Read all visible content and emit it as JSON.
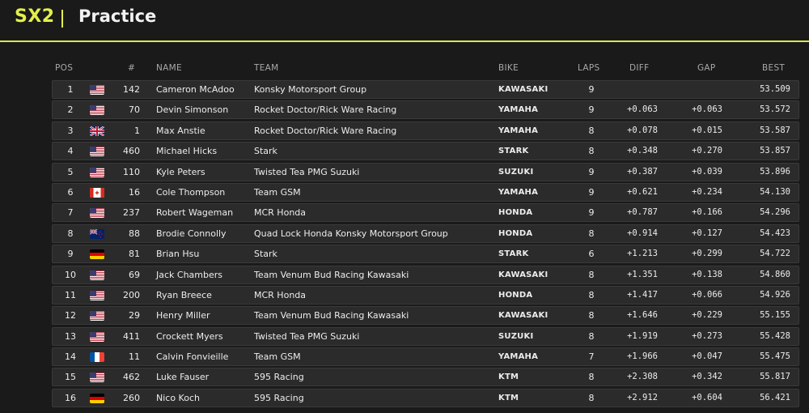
{
  "header": {
    "series": "SX2",
    "title": "Practice"
  },
  "columns": {
    "pos": "POS",
    "num": "#",
    "name": "NAME",
    "team": "TEAM",
    "bike": "BIKE",
    "laps": "LAPS",
    "diff": "DIFF",
    "gap": "GAP",
    "best": "BEST"
  },
  "colors": {
    "accent": "#e2f04a",
    "row_bg": "#2b2b2b",
    "page_bg": "#1a1a1a"
  },
  "rows": [
    {
      "pos": "1",
      "flag": "us-flag",
      "num": "142",
      "name": "Cameron McAdoo",
      "team": "Konsky Motorsport Group",
      "bike": "KAWASAKI",
      "laps": "9",
      "diff": "",
      "gap": "",
      "best": "53.509"
    },
    {
      "pos": "2",
      "flag": "us-flag",
      "num": "70",
      "name": "Devin Simonson",
      "team": "Rocket Doctor/Rick Ware Racing",
      "bike": "YAMAHA",
      "laps": "9",
      "diff": "+0.063",
      "gap": "+0.063",
      "best": "53.572"
    },
    {
      "pos": "3",
      "flag": "uk-flag",
      "num": "1",
      "name": "Max Anstie",
      "team": "Rocket Doctor/Rick Ware Racing",
      "bike": "YAMAHA",
      "laps": "8",
      "diff": "+0.078",
      "gap": "+0.015",
      "best": "53.587"
    },
    {
      "pos": "4",
      "flag": "us-flag",
      "num": "460",
      "name": "Michael Hicks",
      "team": "Stark",
      "bike": "STARK",
      "laps": "8",
      "diff": "+0.348",
      "gap": "+0.270",
      "best": "53.857"
    },
    {
      "pos": "5",
      "flag": "us-flag",
      "num": "110",
      "name": "Kyle Peters",
      "team": "Twisted Tea PMG Suzuki",
      "bike": "SUZUKI",
      "laps": "9",
      "diff": "+0.387",
      "gap": "+0.039",
      "best": "53.896"
    },
    {
      "pos": "6",
      "flag": "ca-flag",
      "num": "16",
      "name": "Cole Thompson",
      "team": "Team GSM",
      "bike": "YAMAHA",
      "laps": "9",
      "diff": "+0.621",
      "gap": "+0.234",
      "best": "54.130"
    },
    {
      "pos": "7",
      "flag": "us-flag",
      "num": "237",
      "name": "Robert Wageman",
      "team": "MCR Honda",
      "bike": "HONDA",
      "laps": "9",
      "diff": "+0.787",
      "gap": "+0.166",
      "best": "54.296"
    },
    {
      "pos": "8",
      "flag": "nz-flag",
      "num": "88",
      "name": "Brodie Connolly",
      "team": "Quad Lock Honda Konsky Motorsport Group",
      "bike": "HONDA",
      "laps": "8",
      "diff": "+0.914",
      "gap": "+0.127",
      "best": "54.423"
    },
    {
      "pos": "9",
      "flag": "de-flag",
      "num": "81",
      "name": "Brian Hsu",
      "team": "Stark",
      "bike": "STARK",
      "laps": "6",
      "diff": "+1.213",
      "gap": "+0.299",
      "best": "54.722"
    },
    {
      "pos": "10",
      "flag": "us-flag",
      "num": "69",
      "name": "Jack Chambers",
      "team": "Team Venum Bud Racing Kawasaki",
      "bike": "KAWASAKI",
      "laps": "8",
      "diff": "+1.351",
      "gap": "+0.138",
      "best": "54.860"
    },
    {
      "pos": "11",
      "flag": "us-flag",
      "num": "200",
      "name": "Ryan Breece",
      "team": "MCR Honda",
      "bike": "HONDA",
      "laps": "8",
      "diff": "+1.417",
      "gap": "+0.066",
      "best": "54.926"
    },
    {
      "pos": "12",
      "flag": "us-flag",
      "num": "29",
      "name": "Henry Miller",
      "team": "Team Venum Bud Racing Kawasaki",
      "bike": "KAWASAKI",
      "laps": "8",
      "diff": "+1.646",
      "gap": "+0.229",
      "best": "55.155"
    },
    {
      "pos": "13",
      "flag": "us-flag",
      "num": "411",
      "name": "Crockett Myers",
      "team": "Twisted Tea PMG Suzuki",
      "bike": "SUZUKI",
      "laps": "8",
      "diff": "+1.919",
      "gap": "+0.273",
      "best": "55.428"
    },
    {
      "pos": "14",
      "flag": "fr-flag",
      "num": "11",
      "name": "Calvin Fonvieille",
      "team": "Team GSM",
      "bike": "YAMAHA",
      "laps": "7",
      "diff": "+1.966",
      "gap": "+0.047",
      "best": "55.475"
    },
    {
      "pos": "15",
      "flag": "us-flag",
      "num": "462",
      "name": "Luke Fauser",
      "team": "595 Racing",
      "bike": "KTM",
      "laps": "8",
      "diff": "+2.308",
      "gap": "+0.342",
      "best": "55.817"
    },
    {
      "pos": "16",
      "flag": "de-flag",
      "num": "260",
      "name": "Nico Koch",
      "team": "595 Racing",
      "bike": "KTM",
      "laps": "8",
      "diff": "+2.912",
      "gap": "+0.604",
      "best": "56.421"
    }
  ]
}
